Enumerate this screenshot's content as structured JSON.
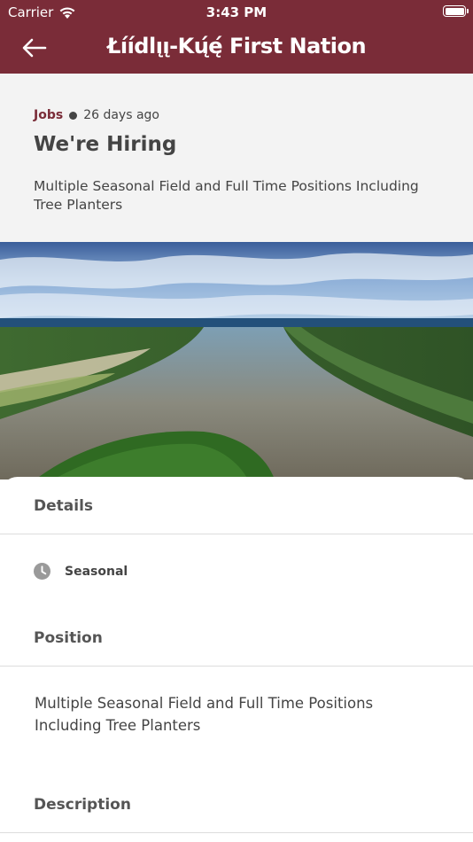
{
  "status_bar": {
    "carrier": "Carrier",
    "time": "3:43 PM"
  },
  "nav": {
    "title": "Łı́ı́dlı̨ı̨-Kų́ę́ First Nation",
    "back_icon": "arrow-left-icon"
  },
  "post": {
    "category": "Jobs",
    "age": "26 days ago",
    "title": "We're Hiring",
    "summary": "Multiple Seasonal Field and Full Time Positions Including Tree Planters"
  },
  "details": {
    "heading": "Details",
    "employment_type": "Seasonal",
    "type_icon": "clock-icon"
  },
  "position": {
    "heading": "Position",
    "text": "Multiple Seasonal Field and Full Time Positions Including Tree Planters"
  },
  "description": {
    "heading": "Description"
  },
  "colors": {
    "brand": "#7a2c38",
    "summary_bg": "#f3f3f3",
    "text": "#444444"
  }
}
